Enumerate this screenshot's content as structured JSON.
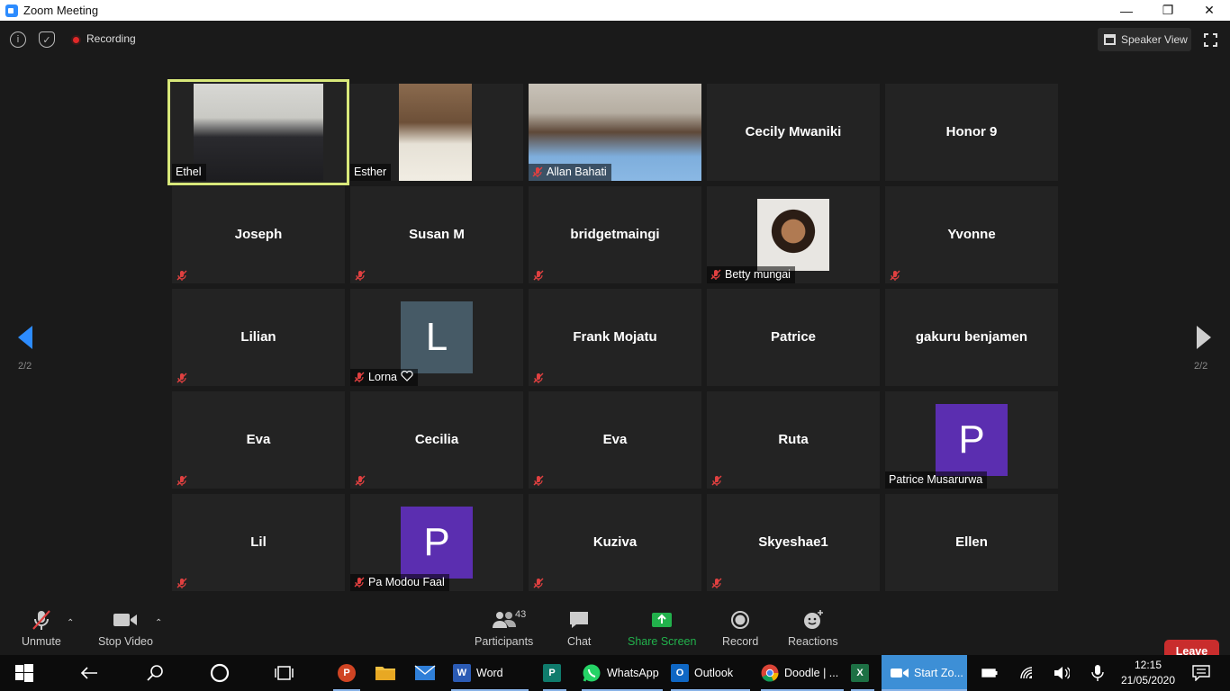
{
  "window": {
    "title": "Zoom Meeting"
  },
  "topbar": {
    "recording_label": "Recording",
    "speaker_view_label": "Speaker View"
  },
  "nav": {
    "left_page": "2/2",
    "right_page": "2/2"
  },
  "tiles": [
    {
      "name": "Ethel",
      "style": "video",
      "muted": false,
      "active": true
    },
    {
      "name": "Esther",
      "style": "video",
      "muted": false
    },
    {
      "name": "Allan Bahati",
      "style": "video",
      "muted": true
    },
    {
      "name": "Cecily Mwaniki",
      "style": "center"
    },
    {
      "name": "Honor 9",
      "style": "center"
    },
    {
      "name": "Joseph",
      "style": "center",
      "muted": true
    },
    {
      "name": "Susan M",
      "style": "center",
      "muted": true
    },
    {
      "name": "bridgetmaingi",
      "style": "center",
      "muted": true
    },
    {
      "name": "Betty mungai",
      "style": "photo",
      "muted": true
    },
    {
      "name": "Yvonne",
      "style": "center",
      "muted": true
    },
    {
      "name": "Lilian",
      "style": "center",
      "muted": true
    },
    {
      "name": "Lorna",
      "style": "avatar",
      "letter": "L",
      "color": "#465a66",
      "muted": true,
      "heart": true
    },
    {
      "name": "Frank Mojatu",
      "style": "center",
      "muted": true
    },
    {
      "name": "Patrice",
      "style": "center"
    },
    {
      "name": "gakuru benjamen",
      "style": "center"
    },
    {
      "name": "Eva",
      "style": "center",
      "muted": true
    },
    {
      "name": "Cecilia",
      "style": "center",
      "muted": true
    },
    {
      "name": "Eva",
      "style": "center",
      "muted": true
    },
    {
      "name": "Ruta",
      "style": "center",
      "muted": true
    },
    {
      "name": "Patrice Musarurwa",
      "style": "avatar",
      "letter": "P",
      "color": "#5b2eb0",
      "muted": false
    },
    {
      "name": "Lil",
      "style": "center",
      "muted": true
    },
    {
      "name": "Pa Modou Faal",
      "style": "avatar",
      "letter": "P",
      "color": "#5b2eb0",
      "muted": true
    },
    {
      "name": "Kuziva",
      "style": "center",
      "muted": true
    },
    {
      "name": "Skyeshae1",
      "style": "center",
      "muted": true
    },
    {
      "name": "Ellen",
      "style": "center"
    }
  ],
  "toolbar": {
    "unmute_label": "Unmute",
    "stop_video_label": "Stop Video",
    "participants_label": "Participants",
    "participants_count": "43",
    "chat_label": "Chat",
    "share_screen_label": "Share Screen",
    "record_label": "Record",
    "reactions_label": "Reactions",
    "leave_label": "Leave"
  },
  "taskbar": {
    "word_label": "Word",
    "whatsapp_label": "WhatsApp",
    "outlook_label": "Outlook",
    "chrome_label": "Doodle | ...",
    "zoom_label": "Start Zo...",
    "time": "12:15",
    "date": "21/05/2020"
  },
  "colors": {
    "active_speaker": "#d8e87a",
    "share_green": "#22b14c",
    "leave_red": "#c92d2d",
    "mute_red": "#e04040"
  }
}
